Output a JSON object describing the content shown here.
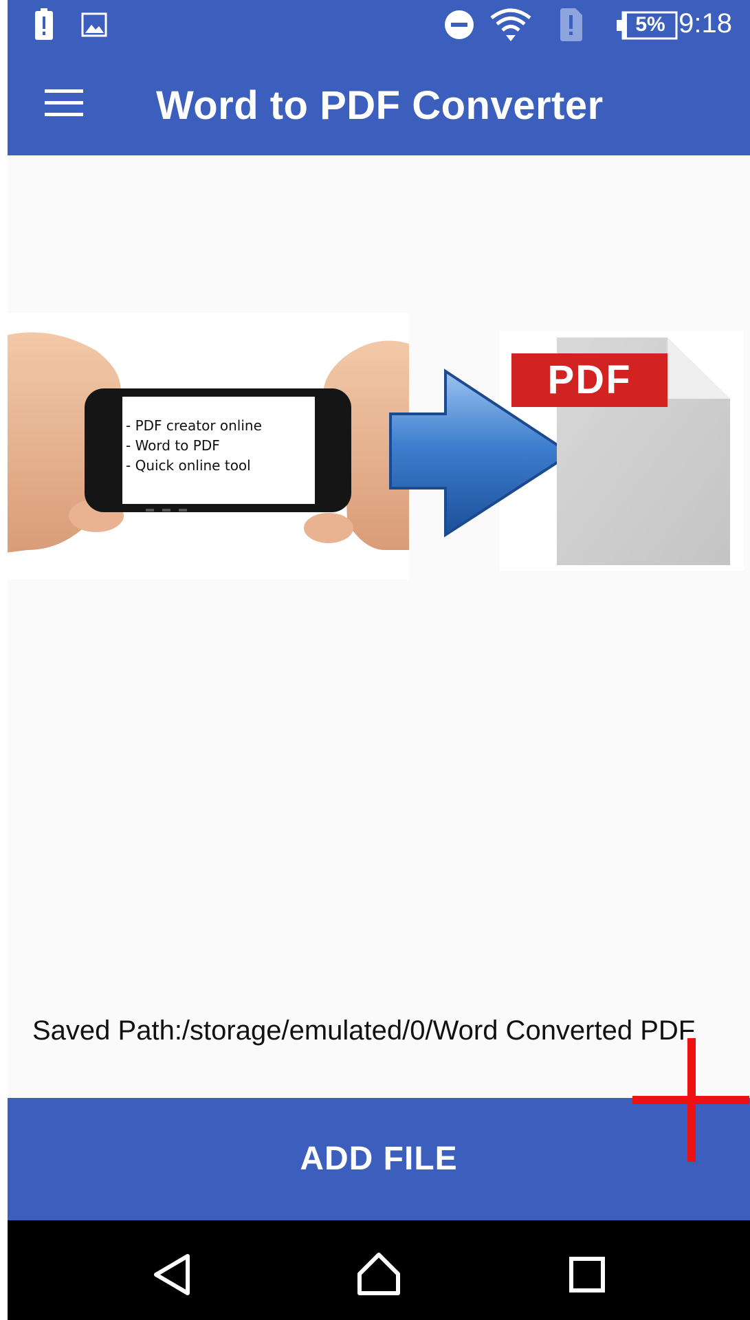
{
  "status_bar": {
    "time": "9:18",
    "battery_percent": "5%",
    "icons": [
      "battery-alert-icon",
      "image-notification-icon",
      "do-not-disturb-icon",
      "wifi-icon",
      "sim-alert-icon",
      "battery-icon"
    ]
  },
  "app_bar": {
    "menu_icon": "hamburger-menu-icon",
    "title": "Word to PDF Converter"
  },
  "banner": {
    "phone_screen_lines": [
      "- PDF creator online",
      "- Word to PDF",
      "- Quick online tool"
    ],
    "pdf_label": "PDF",
    "arrow_icon": "blue-arrow-right-icon",
    "document_icon": "pdf-document-icon"
  },
  "saved_path": {
    "text": "Saved Path:/storage/emulated/0/Word Converted PDF"
  },
  "add_file_button": {
    "label": "ADD FILE"
  },
  "overlay": {
    "icon": "red-plus-icon",
    "color": "#ee1111"
  },
  "nav_bar": {
    "back_icon": "back-triangle-icon",
    "home_icon": "home-icon",
    "recents_icon": "recents-square-icon"
  },
  "colors": {
    "primary": "#3c5fbe",
    "background": "#fafafa",
    "pdf_red": "#d32222"
  }
}
